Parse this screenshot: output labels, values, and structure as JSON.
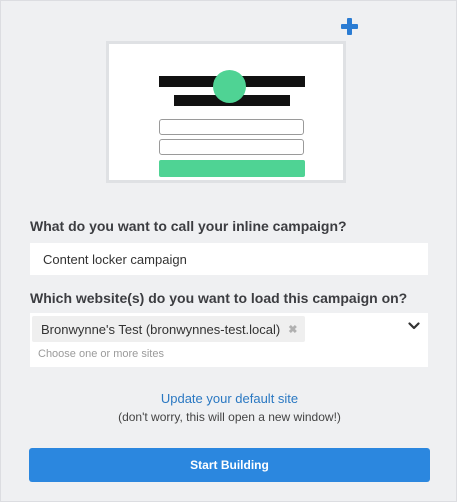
{
  "illustration": {
    "accent_color": "#4fd394",
    "plus_color": "#2b7cd3",
    "plus_icon": "plus-icon"
  },
  "form": {
    "name_question": "What do you want to call your inline campaign?",
    "name_value": "Content locker campaign",
    "sites_question": "Which website(s) do you want to load this campaign on?",
    "selected_site": "Bronwynne's Test (bronwynnes-test.local)",
    "remove_icon": "✖",
    "sites_placeholder": "Choose one or more sites",
    "dropdown_icon": "chevron-down-icon"
  },
  "update_link": "Update your default site",
  "update_note": "(don't worry, this will open a new window!)",
  "start_button": "Start Building",
  "colors": {
    "primary": "#2b87df",
    "link": "#2a78c2"
  }
}
